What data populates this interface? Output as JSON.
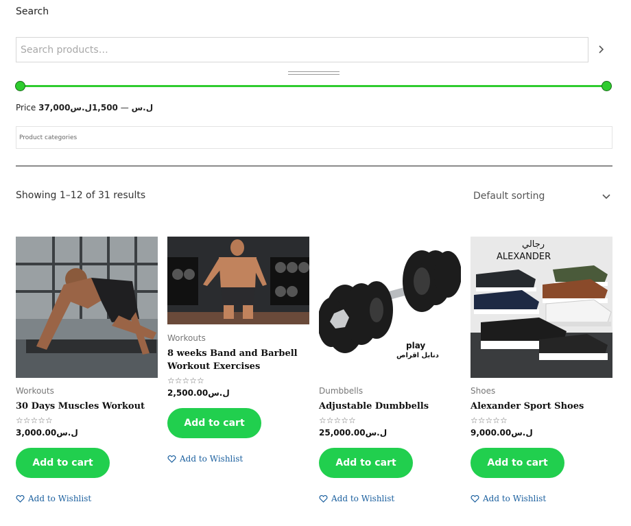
{
  "search": {
    "heading": "Search",
    "placeholder": "Search products…"
  },
  "price_filter": {
    "label": "Price",
    "min": "37,000ل.س",
    "max": "1,500ل.س",
    "separator": "—"
  },
  "categories": {
    "placeholder": "Product categories"
  },
  "results": {
    "count_text": "Showing 1–12 of 31 results",
    "sorting": "Default sorting"
  },
  "products": [
    {
      "category": "Workouts",
      "title": "30 Days Muscles Workout",
      "stars": "☆☆☆☆☆",
      "price": "3,000.00ل.س",
      "cta": "Add to cart",
      "wishlist": "Add to Wishlist"
    },
    {
      "category": "Workouts",
      "title": "8 weeks Band and Barbell Workout Exercises",
      "stars": "☆☆☆☆☆",
      "price": "2,500.00ل.س",
      "cta": "Add to cart",
      "wishlist": "Add to Wishlist"
    },
    {
      "category": "Dumbbells",
      "title": "Adjustable Dumbbells",
      "stars": "☆☆☆☆☆",
      "price": "25,000.00ل.س",
      "cta": "Add to cart",
      "wishlist": "Add to Wishlist",
      "image_text": "play",
      "image_text_ar": "دنابل اقراص"
    },
    {
      "category": "Shoes",
      "title": "Alexander Sport Shoes",
      "stars": "☆☆☆☆☆",
      "price": "9,000.00ل.س",
      "cta": "Add to cart",
      "wishlist": "Add to Wishlist",
      "image_text_ar": "رجالي",
      "image_brand": "ALEXANDER"
    }
  ],
  "colors": {
    "accent": "#21cf4e",
    "slider": "#2ecc2e",
    "link": "#1a5f9e"
  }
}
